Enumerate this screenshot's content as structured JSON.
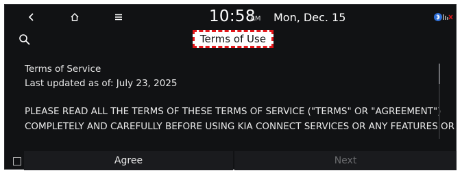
{
  "status_bar": {
    "back_icon": "chevron-left-icon",
    "home_icon": "home-icon",
    "menu_icon": "hamburger-menu-icon",
    "time": "10:58",
    "ampm": "AM",
    "date": "Mon, Dec. 15",
    "system_icons": "bluetooth-and-connectivity-icons"
  },
  "header": {
    "search_icon": "search-icon",
    "title": "Terms of Use",
    "title_highlight_color": "#e3171a"
  },
  "document": {
    "lines": [
      "Terms of Service",
      "Last updated as of:  July 23, 2025",
      "PLEASE READ ALL THE TERMS OF THESE TERMS OF SERVICE (\"TERMS\" OR \"AGREEMENT\")",
      "COMPLETELY AND CAREFULLY BEFORE USING KIA CONNECT SERVICES OR ANY FEATURES OR"
    ]
  },
  "footer": {
    "checkbox_checked": false,
    "agree_label": "Agree",
    "next_label": "Next",
    "next_enabled": false
  },
  "colors": {
    "background": "#111214",
    "text": "#e8e8e8",
    "disabled_text": "#6a6b6e"
  }
}
